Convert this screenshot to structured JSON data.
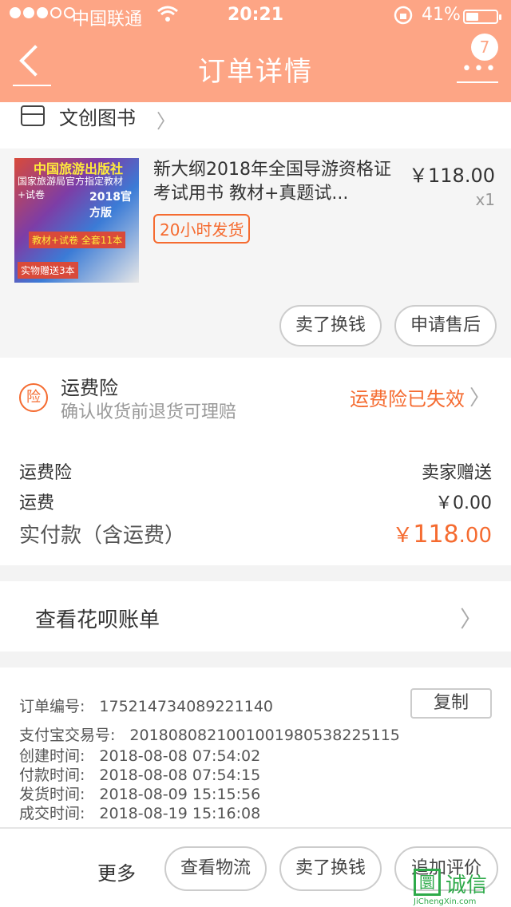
{
  "status_bar": {
    "carrier": "中国联通",
    "time": "20:21",
    "battery": "41%",
    "battery_level": 0.41,
    "signal_dots": [
      true,
      true,
      true,
      false,
      false
    ],
    "icons": [
      "wifi-icon",
      "rotation-lock-icon",
      "battery-icon"
    ]
  },
  "header": {
    "title": "订单详情",
    "badge": "7",
    "back_icon": "back-arrow-icon",
    "more_icon": "more-dots-icon",
    "background": "#fda585"
  },
  "shop": {
    "name": "文创图书",
    "icon": "store-icon"
  },
  "product": {
    "title": "新大纲2018年全国导游资格证考试用书 教材+真题试...",
    "price": "￥118.00",
    "qty": "x1",
    "shipping_tag": "20小时发货",
    "thumb_text": [
      "中国旅游出版社",
      "国家旅游局官方指定教材+试卷",
      "2018官方版",
      "教材+试卷 全套11本",
      "实物赠送3本"
    ],
    "actions": [
      "卖了换钱",
      "申请售后"
    ]
  },
  "insurance": {
    "title": "运费险",
    "subtitle": "确认收货前退货可理赔",
    "status": "运费险已失效",
    "icon_text": "险"
  },
  "fees": {
    "rows": [
      {
        "label": "运费险",
        "value": "卖家赠送"
      },
      {
        "label": "运费",
        "value": "￥0.00"
      }
    ],
    "total_label": "实付款（含运费）",
    "total_currency": "￥",
    "total_int": "118",
    "total_dec": ".00",
    "accent": "#f56b30"
  },
  "huabei": {
    "label": "查看花呗账单"
  },
  "order_info": {
    "copy_label": "复制",
    "rows": [
      {
        "label": "订单编号:",
        "value": "175214734089221140"
      },
      {
        "label": "支付宝交易号:",
        "value": "2018080821001001980538225115"
      },
      {
        "label": "创建时间:",
        "value": "2018-08-08 07:54:02"
      },
      {
        "label": "付款时间:",
        "value": "2018-08-08 07:54:15"
      },
      {
        "label": "发货时间:",
        "value": "2018-08-09 15:15:56"
      },
      {
        "label": "成交时间:",
        "value": "2018-08-19 15:16:08"
      }
    ]
  },
  "bottom_bar": {
    "more": "更多",
    "buttons": [
      "查看物流",
      "卖了换钱",
      "追加评价"
    ]
  },
  "watermark": {
    "box": "圜",
    "text": "诚信",
    "site": "JiChengXin.com"
  }
}
